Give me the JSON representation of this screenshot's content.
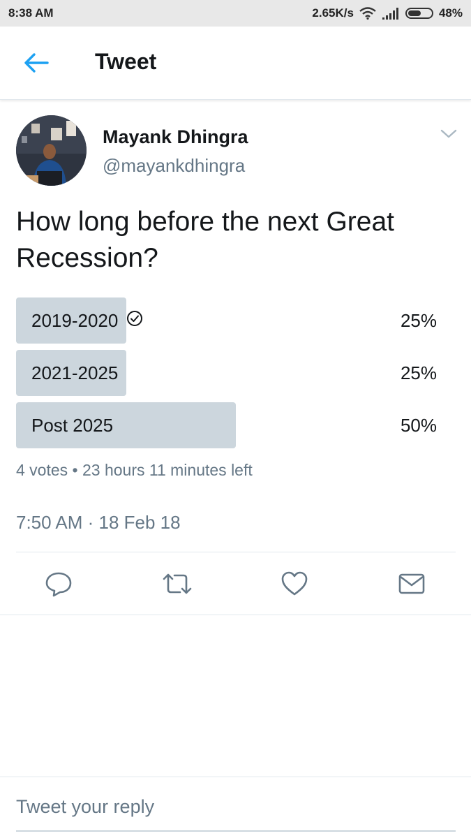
{
  "status_bar": {
    "time": "8:38 AM",
    "speed": "2.65K/s",
    "battery": "48%"
  },
  "header": {
    "title": "Tweet",
    "back_icon": "arrow-left-icon",
    "accent_color": "#1da1f2"
  },
  "tweet": {
    "author_name": "Mayank Dhingra",
    "author_handle": "@mayankdhingra",
    "text": "How long before the next Great Recession?",
    "poll": {
      "options": [
        {
          "label": "2019-2020",
          "percent": "25%",
          "fraction": 0.25,
          "voted": true
        },
        {
          "label": "2021-2025",
          "percent": "25%",
          "fraction": 0.25,
          "voted": false
        },
        {
          "label": "Post 2025",
          "percent": "50%",
          "fraction": 0.5,
          "voted": false
        }
      ],
      "meta": "4 votes • 23 hours 11 minutes left"
    },
    "timestamp": "7:50 AM · 18 Feb 18",
    "actions": [
      "reply-icon",
      "retweet-icon",
      "like-icon",
      "direct-message-icon"
    ]
  },
  "reply": {
    "placeholder": "Tweet your reply"
  }
}
